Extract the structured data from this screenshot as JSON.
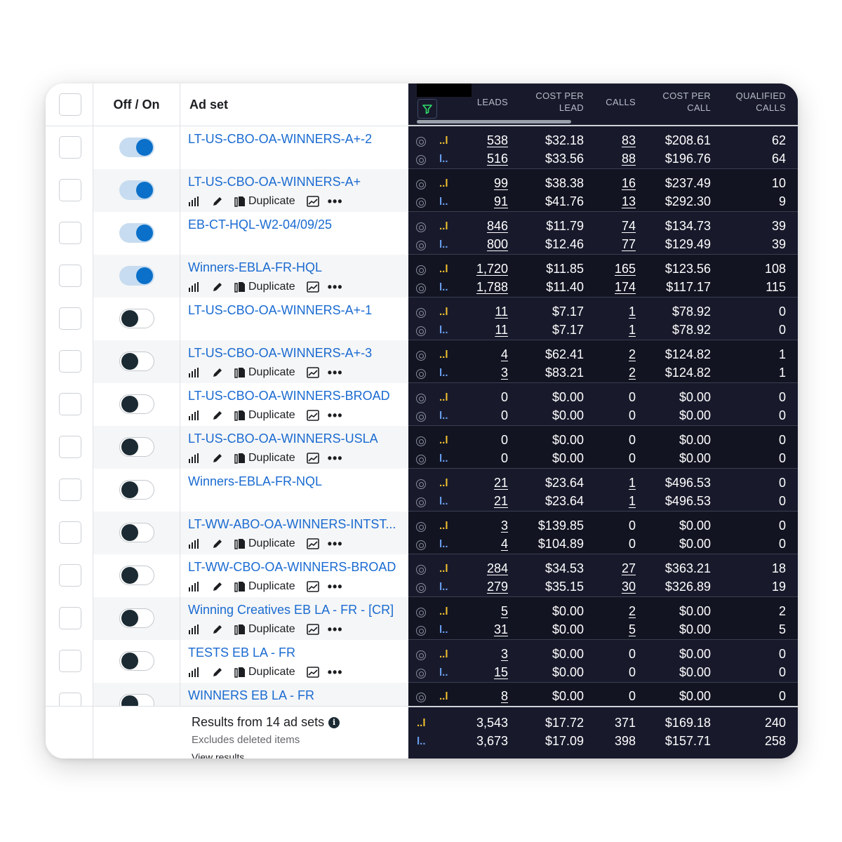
{
  "header": {
    "toggle_label": "Off / On",
    "adset_label": "Ad set",
    "columns": [
      "LEADS",
      "COST PER LEAD",
      "CALLS",
      "COST PER CALL",
      "QUALIFIED CALLS"
    ],
    "col_l1": [
      "",
      "COST PER",
      "",
      "COST PER",
      "QUALIFIED"
    ],
    "col_l2": [
      "LEADS",
      "LEAD",
      "CALLS",
      "CALL",
      "CALLS"
    ]
  },
  "icons": {
    "filter": "filter-icon",
    "chart": "bar-chart-icon",
    "edit": "pencil-icon",
    "duplicate": "copy-icon",
    "open": "open-chart-icon",
    "more": "more-icon",
    "info": "info-icon",
    "attribution": "attribution-icon"
  },
  "colors": {
    "accent": "#1a6bd1",
    "toggle_on": "#0a70c9",
    "dark_panel": "#181a2c",
    "tag_yellow": "#f2c230",
    "tag_blue": "#6a9ff0"
  },
  "actions": {
    "duplicate_label": "Duplicate",
    "more_label": "•••"
  },
  "rows": [
    {
      "name": "LT-US-CBO-OA-WINNERS-A+-2",
      "on": true,
      "actions": false,
      "l1": {
        "tag": "..l",
        "leads": "538",
        "cpl": "$32.18",
        "calls": "83",
        "cpc": "$208.61",
        "qual": "62"
      },
      "l2": {
        "tag": "l..",
        "leads": "516",
        "cpl": "$33.56",
        "calls": "88",
        "cpc": "$196.76",
        "qual": "64"
      }
    },
    {
      "name": "LT-US-CBO-OA-WINNERS-A+",
      "on": true,
      "actions": true,
      "l1": {
        "tag": "..l",
        "leads": "99",
        "cpl": "$38.38",
        "calls": "16",
        "cpc": "$237.49",
        "qual": "10"
      },
      "l2": {
        "tag": "l..",
        "leads": "91",
        "cpl": "$41.76",
        "calls": "13",
        "cpc": "$292.30",
        "qual": "9"
      }
    },
    {
      "name": "EB-CT-HQL-W2-04/09/25",
      "on": true,
      "actions": false,
      "l1": {
        "tag": "..l",
        "leads": "846",
        "cpl": "$11.79",
        "calls": "74",
        "cpc": "$134.73",
        "qual": "39"
      },
      "l2": {
        "tag": "l..",
        "leads": "800",
        "cpl": "$12.46",
        "calls": "77",
        "cpc": "$129.49",
        "qual": "39"
      }
    },
    {
      "name": "Winners-EBLA-FR-HQL",
      "on": true,
      "actions": true,
      "l1": {
        "tag": "..l",
        "leads": "1,720",
        "cpl": "$11.85",
        "calls": "165",
        "cpc": "$123.56",
        "qual": "108"
      },
      "l2": {
        "tag": "l..",
        "leads": "1,788",
        "cpl": "$11.40",
        "calls": "174",
        "cpc": "$117.17",
        "qual": "115"
      }
    },
    {
      "name": "LT-US-CBO-OA-WINNERS-A+-1",
      "on": false,
      "actions": false,
      "l1": {
        "tag": "..l",
        "leads": "11",
        "cpl": "$7.17",
        "calls": "1",
        "cpc": "$78.92",
        "qual": "0"
      },
      "l2": {
        "tag": "l..",
        "leads": "11",
        "cpl": "$7.17",
        "calls": "1",
        "cpc": "$78.92",
        "qual": "0"
      }
    },
    {
      "name": "LT-US-CBO-OA-WINNERS-A+-3",
      "on": false,
      "actions": true,
      "l1": {
        "tag": "..l",
        "leads": "4",
        "cpl": "$62.41",
        "calls": "2",
        "cpc": "$124.82",
        "qual": "1"
      },
      "l2": {
        "tag": "l..",
        "leads": "3",
        "cpl": "$83.21",
        "calls": "2",
        "cpc": "$124.82",
        "qual": "1"
      }
    },
    {
      "name": "LT-US-CBO-OA-WINNERS-BROAD",
      "on": false,
      "actions": true,
      "l1": {
        "tag": "..l",
        "leads": "0",
        "cpl": "$0.00",
        "calls": "0",
        "cpc": "$0.00",
        "qual": "0"
      },
      "l2": {
        "tag": "l..",
        "leads": "0",
        "cpl": "$0.00",
        "calls": "0",
        "cpc": "$0.00",
        "qual": "0"
      }
    },
    {
      "name": "LT-US-CBO-OA-WINNERS-USLA",
      "on": false,
      "actions": true,
      "l1": {
        "tag": "..l",
        "leads": "0",
        "cpl": "$0.00",
        "calls": "0",
        "cpc": "$0.00",
        "qual": "0"
      },
      "l2": {
        "tag": "l..",
        "leads": "0",
        "cpl": "$0.00",
        "calls": "0",
        "cpc": "$0.00",
        "qual": "0"
      }
    },
    {
      "name": "Winners-EBLA-FR-NQL",
      "on": false,
      "actions": false,
      "l1": {
        "tag": "..l",
        "leads": "21",
        "cpl": "$23.64",
        "calls": "1",
        "cpc": "$496.53",
        "qual": "0"
      },
      "l2": {
        "tag": "l..",
        "leads": "21",
        "cpl": "$23.64",
        "calls": "1",
        "cpc": "$496.53",
        "qual": "0"
      }
    },
    {
      "name": "LT-WW-ABO-OA-WINNERS-INTST...",
      "on": false,
      "actions": true,
      "l1": {
        "tag": "..l",
        "leads": "3",
        "cpl": "$139.85",
        "calls": "0",
        "cpc": "$0.00",
        "qual": "0"
      },
      "l2": {
        "tag": "l..",
        "leads": "4",
        "cpl": "$104.89",
        "calls": "0",
        "cpc": "$0.00",
        "qual": "0"
      }
    },
    {
      "name": "LT-WW-CBO-OA-WINNERS-BROAD",
      "on": false,
      "actions": true,
      "l1": {
        "tag": "..l",
        "leads": "284",
        "cpl": "$34.53",
        "calls": "27",
        "cpc": "$363.21",
        "qual": "18"
      },
      "l2": {
        "tag": "l..",
        "leads": "279",
        "cpl": "$35.15",
        "calls": "30",
        "cpc": "$326.89",
        "qual": "19"
      }
    },
    {
      "name": "Winning Creatives EB LA - FR - [CR]",
      "on": false,
      "actions": true,
      "l1": {
        "tag": "..l",
        "leads": "5",
        "cpl": "$0.00",
        "calls": "2",
        "cpc": "$0.00",
        "qual": "2"
      },
      "l2": {
        "tag": "l..",
        "leads": "31",
        "cpl": "$0.00",
        "calls": "5",
        "cpc": "$0.00",
        "qual": "5"
      }
    },
    {
      "name": "TESTS EB LA - FR",
      "on": false,
      "actions": true,
      "l1": {
        "tag": "..l",
        "leads": "3",
        "cpl": "$0.00",
        "calls": "0",
        "cpc": "$0.00",
        "qual": "0"
      },
      "l2": {
        "tag": "l..",
        "leads": "15",
        "cpl": "$0.00",
        "calls": "0",
        "cpc": "$0.00",
        "qual": "0"
      }
    },
    {
      "name": "WINNERS EB LA - FR",
      "on": false,
      "actions": false,
      "partial": true,
      "l1": {
        "tag": "..l",
        "leads": "8",
        "cpl": "$0.00",
        "calls": "0",
        "cpc": "$0.00",
        "qual": "0"
      }
    }
  ],
  "footer": {
    "results": "Results from 14 ad sets",
    "excludes": "Excludes deleted items",
    "view_results": "View results",
    "l1": {
      "tag": "..l",
      "leads": "3,543",
      "cpl": "$17.72",
      "calls": "371",
      "cpc": "$169.18",
      "qual": "240"
    },
    "l2": {
      "tag": "l..",
      "leads": "3,673",
      "cpl": "$17.09",
      "calls": "398",
      "cpc": "$157.71",
      "qual": "258"
    }
  }
}
